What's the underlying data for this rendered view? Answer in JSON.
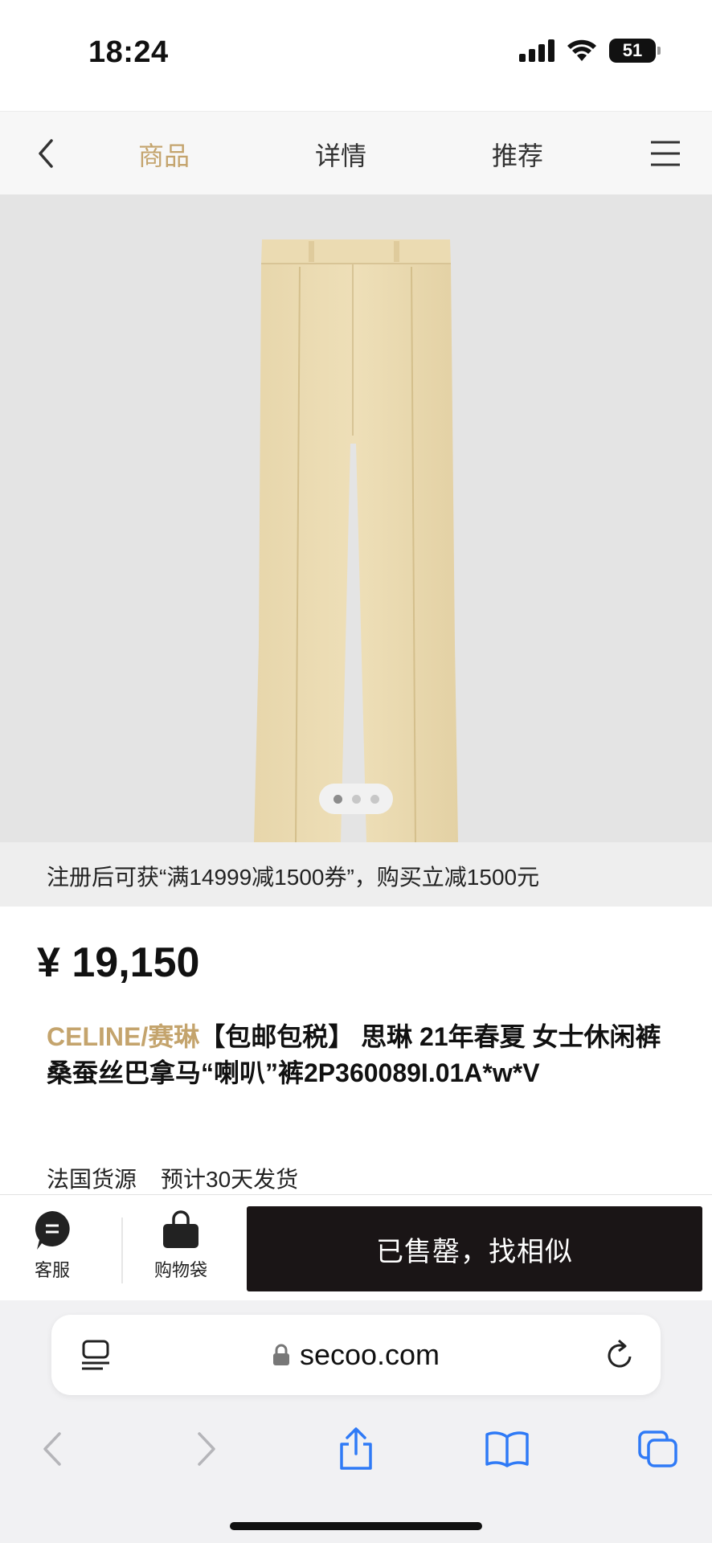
{
  "status_bar": {
    "time": "18:24",
    "battery": "51"
  },
  "nav": {
    "tabs": [
      {
        "label": "商品",
        "active": true
      },
      {
        "label": "详情",
        "active": false
      },
      {
        "label": "推荐",
        "active": false
      }
    ],
    "accent_color": "#c4a46d"
  },
  "gallery": {
    "current": 1,
    "total": 3
  },
  "promo": {
    "text": "注册后可获“满14999减1500券”，购买立减1500元"
  },
  "product": {
    "price": "¥ 19,150",
    "brand": "CELINE/赛琳",
    "title": "【包邮包税】 思琳 21年春夏 女士休闲裤 桑蚕丝巴拿马“喇叭”裤2P360089I.01A*w*V",
    "origin": "法国货源",
    "shipping": "预计30天发货"
  },
  "actions": {
    "service_label": "客服",
    "bag_label": "购物袋",
    "sold_out_label": "已售罄，找相似"
  },
  "browser": {
    "domain": "secoo.com"
  }
}
